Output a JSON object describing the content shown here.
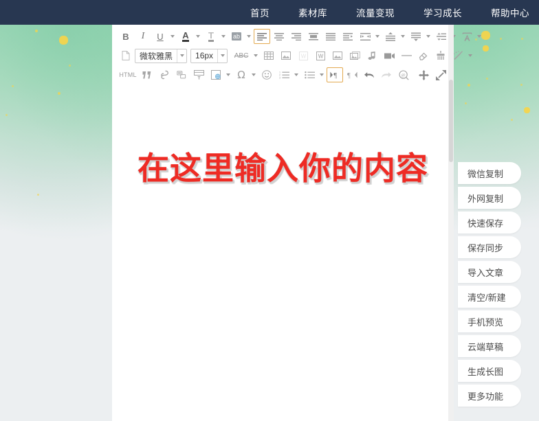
{
  "navbar": {
    "items": [
      {
        "label": "首页",
        "name": "nav-home"
      },
      {
        "label": "素材库",
        "name": "nav-material-library"
      },
      {
        "label": "流量变现",
        "name": "nav-monetization"
      },
      {
        "label": "学习成长",
        "name": "nav-learning"
      },
      {
        "label": "帮助中心",
        "name": "nav-help-center"
      }
    ]
  },
  "toolbar": {
    "row1": [
      {
        "kind": "btn",
        "name": "bold-icon",
        "glyph": "B",
        "style": "bold",
        "active": false
      },
      {
        "kind": "btn",
        "name": "italic-icon",
        "glyph": "I",
        "style": "italic",
        "active": false
      },
      {
        "kind": "btn",
        "name": "underline-icon",
        "glyph": "U",
        "style": "under",
        "active": false
      },
      {
        "kind": "caret",
        "name": "underline-dropdown-caret"
      },
      {
        "kind": "btn",
        "name": "font-color-icon",
        "glyph": "A",
        "style": "colorA",
        "active": false
      },
      {
        "kind": "caret",
        "name": "font-color-dropdown-caret"
      },
      {
        "kind": "btn",
        "name": "text-style-icon",
        "glyph": "T",
        "style": "colorT",
        "active": false
      },
      {
        "kind": "caret",
        "name": "text-style-dropdown-caret"
      },
      {
        "kind": "btn",
        "name": "background-color-icon",
        "glyph": "ab",
        "style": "abbox",
        "active": false
      },
      {
        "kind": "caret",
        "name": "background-color-dropdown-caret"
      },
      {
        "kind": "btn",
        "name": "align-left-icon",
        "glyph": "align-left",
        "active": true
      },
      {
        "kind": "btn",
        "name": "align-center-icon",
        "glyph": "align-center",
        "active": false
      },
      {
        "kind": "btn",
        "name": "align-right-icon",
        "glyph": "align-right",
        "active": false
      },
      {
        "kind": "btn",
        "name": "align-middle-icon",
        "glyph": "align-middle",
        "active": false
      },
      {
        "kind": "btn",
        "name": "align-justify-icon",
        "glyph": "align-justify",
        "active": false
      },
      {
        "kind": "btn",
        "name": "indent-increase-icon",
        "glyph": "indent-in",
        "active": false
      },
      {
        "kind": "btn",
        "name": "indent-decrease-icon",
        "glyph": "indent-out",
        "active": false
      },
      {
        "kind": "caret",
        "name": "indent-dropdown-caret"
      },
      {
        "kind": "btn",
        "name": "line-height-icon",
        "glyph": "line-height",
        "active": false
      },
      {
        "kind": "caret",
        "name": "line-height-dropdown-caret"
      },
      {
        "kind": "btn",
        "name": "paragraph-spacing-icon",
        "glyph": "para-space",
        "active": false
      },
      {
        "kind": "caret",
        "name": "paragraph-spacing-dropdown-caret"
      },
      {
        "kind": "btn",
        "name": "letter-spacing-icon",
        "glyph": "letter-space",
        "active": false
      },
      {
        "kind": "caret",
        "name": "letter-spacing-dropdown-caret"
      },
      {
        "kind": "btn",
        "name": "font-scale-icon",
        "glyph": "font-scale",
        "active": false
      },
      {
        "kind": "caret",
        "name": "font-scale-dropdown-caret"
      }
    ],
    "row2_prefix": [
      {
        "kind": "btn",
        "name": "clear-format-icon",
        "glyph": "page"
      }
    ],
    "font_family": {
      "name": "font-family-select",
      "value": "微软雅黑"
    },
    "font_size": {
      "name": "font-size-select",
      "value": "16px"
    },
    "strikethrough_label": "ABC",
    "row2_suffix": [
      {
        "kind": "btn",
        "name": "table-icon",
        "glyph": "table"
      },
      {
        "kind": "btn",
        "name": "insert-image-icon",
        "glyph": "image"
      },
      {
        "kind": "btn",
        "name": "word-import-disabled-icon",
        "glyph": "word-faded"
      },
      {
        "kind": "btn",
        "name": "word-import-icon",
        "glyph": "word"
      },
      {
        "kind": "btn",
        "name": "picture-icon",
        "glyph": "image"
      },
      {
        "kind": "btn",
        "name": "gallery-icon",
        "glyph": "gallery"
      },
      {
        "kind": "btn",
        "name": "music-icon",
        "glyph": "music"
      },
      {
        "kind": "btn",
        "name": "video-icon",
        "glyph": "video"
      },
      {
        "kind": "btn",
        "name": "horizontal-rule-icon",
        "glyph": "hr"
      },
      {
        "kind": "btn",
        "name": "eraser-icon",
        "glyph": "eraser"
      },
      {
        "kind": "btn",
        "name": "clean-brush-icon",
        "glyph": "brush"
      },
      {
        "kind": "btn",
        "name": "magic-wand-icon",
        "glyph": "wand"
      },
      {
        "kind": "caret",
        "name": "magic-wand-dropdown-caret"
      }
    ],
    "row3": [
      {
        "kind": "html",
        "name": "html-source-icon",
        "label": "HTML"
      },
      {
        "kind": "btn",
        "name": "blockquote-icon",
        "glyph": "quote"
      },
      {
        "kind": "btn",
        "name": "link-icon",
        "glyph": "link"
      },
      {
        "kind": "btn",
        "name": "unlink-icon",
        "glyph": "unlink"
      },
      {
        "kind": "btn",
        "name": "text-template-icon",
        "glyph": "template"
      },
      {
        "kind": "btn",
        "name": "page-style-icon",
        "glyph": "pagestyle"
      },
      {
        "kind": "caret",
        "name": "page-style-dropdown-caret"
      },
      {
        "kind": "btn",
        "name": "special-character-icon",
        "glyph": "omega"
      },
      {
        "kind": "caret",
        "name": "special-character-dropdown-caret"
      },
      {
        "kind": "btn",
        "name": "emoji-icon",
        "glyph": "emoji"
      },
      {
        "kind": "btn",
        "name": "ordered-list-icon",
        "glyph": "ol"
      },
      {
        "kind": "caret",
        "name": "ordered-list-dropdown-caret"
      },
      {
        "kind": "btn",
        "name": "unordered-list-icon",
        "glyph": "ul"
      },
      {
        "kind": "caret",
        "name": "unordered-list-dropdown-caret"
      },
      {
        "kind": "btn",
        "name": "paragraph-mark-ltr-icon",
        "glyph": "pilcrow-ltr",
        "active": true
      },
      {
        "kind": "btn",
        "name": "paragraph-mark-rtl-icon",
        "glyph": "pilcrow-rtl"
      },
      {
        "kind": "btn",
        "name": "undo-icon",
        "glyph": "undo"
      },
      {
        "kind": "btn",
        "name": "redo-icon",
        "glyph": "redo",
        "faded": true
      },
      {
        "kind": "btn",
        "name": "search-icon",
        "glyph": "search"
      }
    ],
    "row3_right": [
      {
        "kind": "btn",
        "name": "move-icon",
        "glyph": "move"
      },
      {
        "kind": "btn",
        "name": "fullscreen-icon",
        "glyph": "fullscreen"
      }
    ]
  },
  "canvas": {
    "headline": "在这里输入你的内容"
  },
  "rail": {
    "buttons": [
      {
        "label": "微信复制",
        "name": "rail-wechat-copy"
      },
      {
        "label": "外网复制",
        "name": "rail-external-copy"
      },
      {
        "label": "快速保存",
        "name": "rail-quick-save"
      },
      {
        "label": "保存同步",
        "name": "rail-save-sync"
      },
      {
        "label": "导入文章",
        "name": "rail-import-article"
      },
      {
        "label": "清空/新建",
        "name": "rail-clear-new"
      },
      {
        "label": "手机预览",
        "name": "rail-mobile-preview"
      },
      {
        "label": "云端草稿",
        "name": "rail-cloud-draft"
      },
      {
        "label": "生成长图",
        "name": "rail-generate-long-image"
      },
      {
        "label": "更多功能",
        "name": "rail-more-features"
      }
    ]
  },
  "colors": {
    "navbar_bg": "#283751",
    "headline_red": "#ee2b24",
    "toolbar_active_border": "#e3a94f",
    "bg_green": "#a8dcbf",
    "bg_gray": "#eceff1",
    "particle_yellow": "#f6d44a"
  }
}
